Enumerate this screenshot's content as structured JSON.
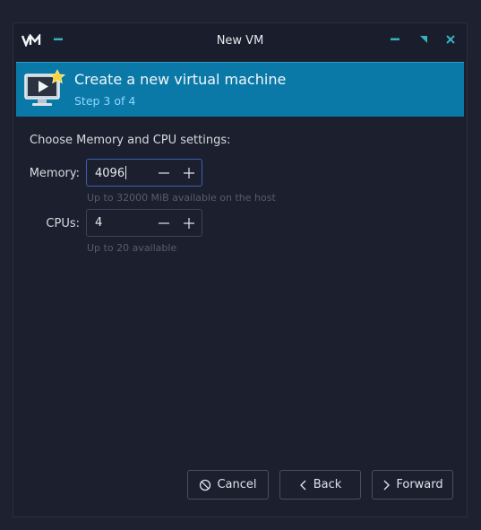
{
  "window": {
    "title": "New VM",
    "icons": {
      "logo": "virt-manager-logo-icon",
      "menu": "window-menu-icon",
      "minimize": "minimize-icon",
      "maximize": "maximize-icon",
      "close": "close-icon"
    }
  },
  "banner": {
    "icon": "new-vm-monitor-icon",
    "title": "Create a new virtual machine",
    "step": "Step 3 of 4"
  },
  "form": {
    "heading": "Choose Memory and CPU settings:",
    "memory": {
      "label": "Memory:",
      "value": "4096",
      "hint": "Up to 32000 MiB available on the host"
    },
    "cpus": {
      "label": "CPUs:",
      "value": "4",
      "hint": "Up to 20 available"
    }
  },
  "buttons": {
    "cancel": "Cancel",
    "back": "Back",
    "forward": "Forward"
  },
  "colors": {
    "banner": "#0b79a8",
    "accent": "#38b0c0",
    "background": "#1c1f2d"
  }
}
